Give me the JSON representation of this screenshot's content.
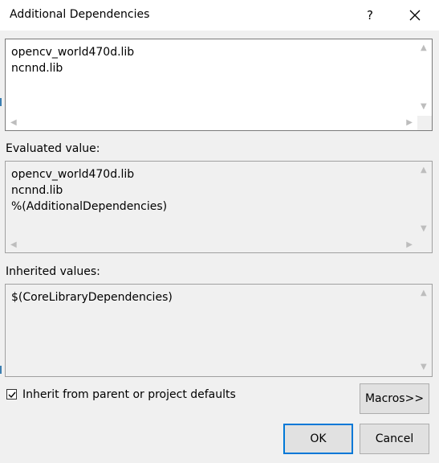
{
  "window": {
    "title": "Additional Dependencies",
    "help_label": "?"
  },
  "edit_box": {
    "lines": "opencv_world470d.lib\nncnnd.lib"
  },
  "evaluated": {
    "label": "Evaluated value:",
    "lines": "opencv_world470d.lib\nncnnd.lib\n%(AdditionalDependencies)"
  },
  "inherited": {
    "label": "Inherited values:",
    "lines": "$(CoreLibraryDependencies)"
  },
  "inherit_checkbox": {
    "label": "Inherit from parent or project defaults",
    "checked": true
  },
  "buttons": {
    "macros": "Macros>>",
    "ok": "OK",
    "cancel": "Cancel"
  },
  "colors": {
    "accent": "#0078d7",
    "edit_bg": "#ffffff",
    "readonly_bg": "#f0f0f0"
  }
}
